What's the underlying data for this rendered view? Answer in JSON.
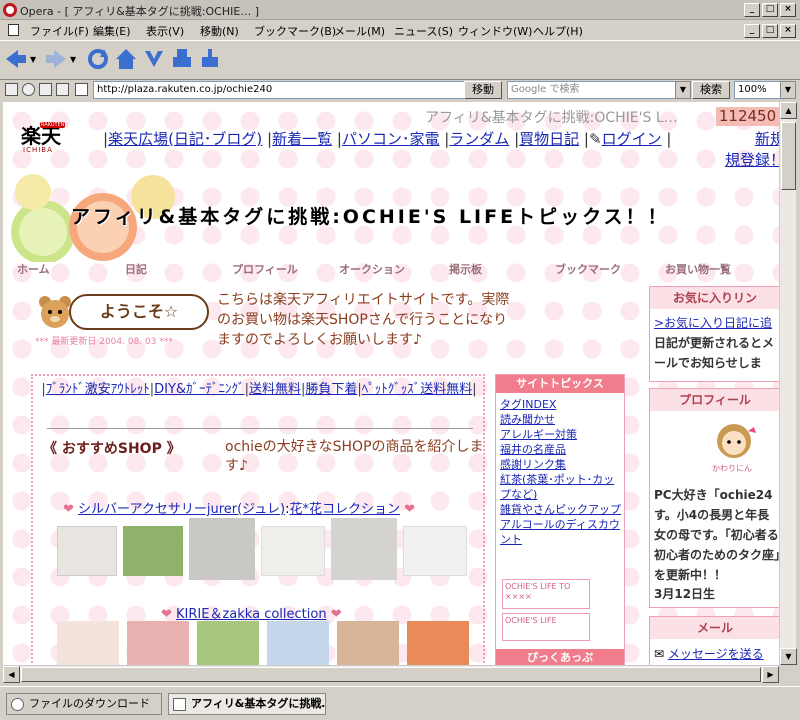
{
  "window": {
    "title": "Opera - [ アフィリ&基本タグに挑戦:OCHIE… ]",
    "min": "_",
    "max": "□",
    "close": "×"
  },
  "menu": [
    "ファイル(F)",
    "編集(E)",
    "表示(V)",
    "移動(N)",
    "ブックマーク(B)",
    "メール(M)",
    "ニュース(S)",
    "ウィンドウ(W)",
    "ヘルプ(H)"
  ],
  "address": {
    "url": "http://plaza.rakuten.co.jp/ochie240",
    "go_label": "移動",
    "search_placeholder": "Google で検索",
    "search_label": "検索",
    "zoom": "100%"
  },
  "site": {
    "logo": "楽天",
    "logo_sub": "ICHIBA",
    "logo_badge": "RAKUTEN",
    "header_title": "アフィリ&基本タグに挑戦:OCHIE'S L…",
    "counter": "112450",
    "nav": [
      "楽天広場(日記･ブログ)",
      "新着一覧",
      "パソコン･家電",
      "ランダム",
      "買物日記",
      "ログイン",
      "新規登録！"
    ],
    "banner_title": "アフィリ&基本タグに挑戦:OCHIE'S LIFEトピックス！！",
    "tabs": [
      "ホーム",
      "日記",
      "プロフィール",
      "オークション",
      "掲示板",
      "ブックマーク",
      "お買い物一覧"
    ],
    "welcome": "ようこそ☆",
    "updated": "*** 最新更新日 2004. 08. 03 ***",
    "intro": "こちらは楽天アフィリエイトサイトです。実際のお買い物は楽天SHOPさんで行うことになりますのでよろしくお願いします♪",
    "category_links": [
      "ﾌﾞﾗﾝﾄﾞ激安ｱｳﾄﾚｯﾄ",
      "DIY&ｶﾞｰﾃﾞﾆﾝｸﾞ",
      "送料無料",
      "勝負下着",
      "ﾍﾟｯﾄｸﾞｯｽﾞ送料無料"
    ],
    "recommend_title": "《 おすすめSHOP 》",
    "recommend_desc": "ochieの大好きなSHOPの商品を紹介します♪",
    "shop1": "シルバーアクセサリーjurer(ジュレ)",
    "shop1b": "花*花コレクション",
    "shop2": "KIRIE＆zakka collection",
    "topics_title": "サイトトピックス",
    "topics": [
      "タグINDEX",
      "読み聞かせ",
      "アレルギー対策",
      "福井の名産品",
      "感謝リンク集",
      "紅茶(茶葉･ポット･カップなど)",
      "雑貨やさんピックアップ",
      "アルコールのディスカウント"
    ],
    "banner_small1": "OCHIE'S LIFE TO ××××",
    "banner_small2": "OCHIE'S LIFE",
    "pickup_title": "ぴっくあっぷ",
    "fav_title": "お気に入りリン",
    "fav_link": ">お気に入り日記に追",
    "fav_desc": "日記が更新されるとメールでお知らせしま",
    "profile_title": "プロフィール",
    "profile_name": "かわりにん",
    "profile_text": "PC大好き「ochie24す。小4の長男と年長女の母です。「初心者る初心者のためのタク座」を更新中！！",
    "profile_date": "3月12日生",
    "mail_title": "メール",
    "mail_link": "メッセージを送る"
  },
  "status": {
    "download": "ファイルのダウンロード",
    "tab": "アフィリ&基本タグに挑戦…"
  }
}
